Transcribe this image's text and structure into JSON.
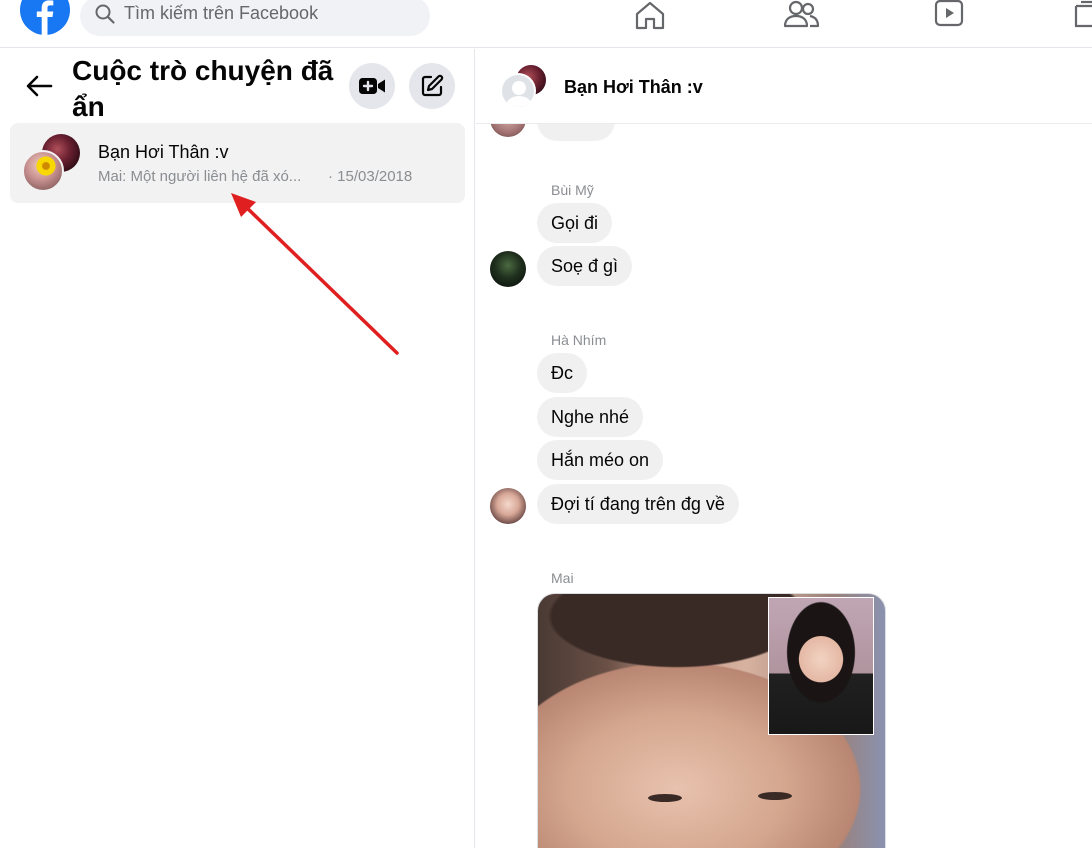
{
  "topbar": {
    "search_placeholder": "Tìm kiếm trên Facebook",
    "nav": [
      "home-icon",
      "friends-icon",
      "watch-icon",
      "marketplace-icon"
    ]
  },
  "left_panel": {
    "title": "Cuộc trò chuyện đã ẩn",
    "conversation": {
      "name": "Bạn Hơi Thân :v",
      "preview": "Mai: Một người liên hệ đã xó...",
      "date": "· 15/03/2018"
    }
  },
  "chat": {
    "header_name": "Bạn Hơi Thân :v",
    "groups": [
      {
        "sender": "Bùi Mỹ",
        "messages": [
          "Gọi đi",
          "Soẹ đ gì"
        ]
      },
      {
        "sender": "Hà Nhím",
        "messages": [
          "Đc",
          "Nghe nhé",
          "Hắn méo on",
          "Đợi tí đang trên đg về"
        ]
      },
      {
        "sender": "Mai"
      }
    ]
  },
  "colors": {
    "facebook_blue": "#1877f2",
    "annotation_red": "#e02020",
    "bubble_gray": "#f0f0f0"
  }
}
